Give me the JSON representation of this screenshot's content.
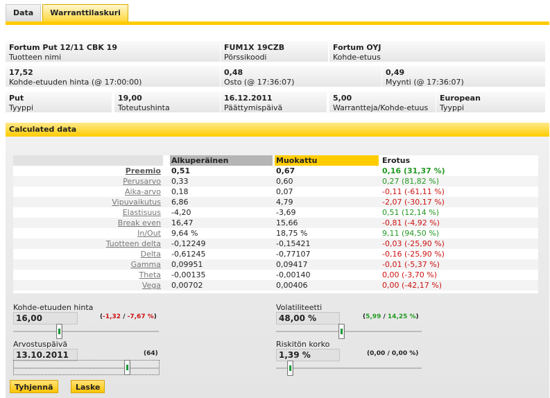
{
  "tabs": [
    {
      "label": "Data",
      "active": false
    },
    {
      "label": "Warranttilaskuri",
      "active": true
    }
  ],
  "info": {
    "name": {
      "value": "Fortum Put 12/11 CBK 19",
      "label": "Tuotteen nimi"
    },
    "code": {
      "value": "FUM1X 19CZB",
      "label": "Pörssikoodi"
    },
    "underlying": {
      "value": "Fortum OYJ",
      "label": "Kohde-etuus"
    },
    "under_price": {
      "value": "17,52",
      "label": "Kohde-etuuden hinta (@  17:00:00)"
    },
    "bid": {
      "value": "0,48",
      "label": "Osto (@ 17:36:07)"
    },
    "ask": {
      "value": "0,49",
      "label": "Myynti (@ 17:36:07)"
    },
    "type": {
      "value": "Put",
      "label": "Tyyppi"
    },
    "strike": {
      "value": "19,00",
      "label": "Toteutushinta"
    },
    "expiry": {
      "value": "16.12.2011",
      "label": "Päättymispäivä"
    },
    "ratio": {
      "value": "5,00",
      "label": "Warrantteja/Kohde-etuus"
    },
    "style": {
      "value": "European",
      "label": "Tyyppi"
    }
  },
  "calc": {
    "title": "Calculated data",
    "headers": {
      "original": "Alkuperäinen",
      "modified": "Muokattu",
      "diff": "Erotus"
    },
    "rows": [
      {
        "name": "Preemio",
        "orig": "0,51",
        "mod": "0,67",
        "diff": "0,16 (31,37 %)",
        "sign": "pos"
      },
      {
        "name": "Perusarvo",
        "orig": "0,33",
        "mod": "0,60",
        "diff": "0,27 (81,82 %)",
        "sign": "pos"
      },
      {
        "name": "Aika-arvo",
        "orig": "0,18",
        "mod": "0,07",
        "diff": "-0,11 (-61,11 %)",
        "sign": "neg"
      },
      {
        "name": "Vipuvaikutus",
        "orig": "6,86",
        "mod": "4,79",
        "diff": "-2,07 (-30,17 %)",
        "sign": "neg"
      },
      {
        "name": "Elastisuus",
        "orig": "-4,20",
        "mod": "-3,69",
        "diff": "0,51 (12,14 %)",
        "sign": "pos"
      },
      {
        "name": "Break even",
        "orig": "16,47",
        "mod": "15,66",
        "diff": "-0,81 (-4,92 %)",
        "sign": "neg"
      },
      {
        "name": "In/Out",
        "orig": "9,64 %",
        "mod": "18,75 %",
        "diff": "9,11 (94,50 %)",
        "sign": "pos"
      },
      {
        "name": "Tuotteen delta",
        "orig": "-0,12249",
        "mod": "-0,15421",
        "diff": "-0,03 (-25,90 %)",
        "sign": "neg"
      },
      {
        "name": "Delta",
        "orig": "-0,61245",
        "mod": "-0,77107",
        "diff": "-0,16 (-25,90 %)",
        "sign": "neg"
      },
      {
        "name": "Gamma",
        "orig": "0,09951",
        "mod": "0,09417",
        "diff": "-0,01 (-5,37 %)",
        "sign": "neg"
      },
      {
        "name": "Theta",
        "orig": "-0,00135",
        "mod": "-0,00140",
        "diff": "0,00 (-3,70 %)",
        "sign": "neg"
      },
      {
        "name": "Vega",
        "orig": "0,00702",
        "mod": "0,00406",
        "diff": "0,00 (-42,17 %)",
        "sign": "neg"
      }
    ]
  },
  "sliders": {
    "price": {
      "label": "Kohde-etuuden hinta",
      "value": "16,00",
      "delta_a": "-1,32",
      "sep": " / ",
      "delta_b": "-7,67 %",
      "sign": "neg",
      "position": 0.31
    },
    "volatility": {
      "label": "Volatiliteetti",
      "value": "48,00 %",
      "delta_a": "5,99",
      "sep": " / ",
      "delta_b": "14,25 %",
      "sign": "pos",
      "position": 0.45
    },
    "date": {
      "label": "Arvostuspäivä",
      "value": "13.10.2011",
      "days": "(64)",
      "position": 0.79
    },
    "rate": {
      "label": "Riskitön korko",
      "value": "1,39 %",
      "delta": "(0,00 / 0,00 %)",
      "position": 0.08
    }
  },
  "buttons": {
    "clear": "Tyhjennä",
    "calc": "Laske"
  },
  "colors": {
    "accent": "#ffcc00",
    "positive": "#229922",
    "negative": "#cc1111"
  }
}
